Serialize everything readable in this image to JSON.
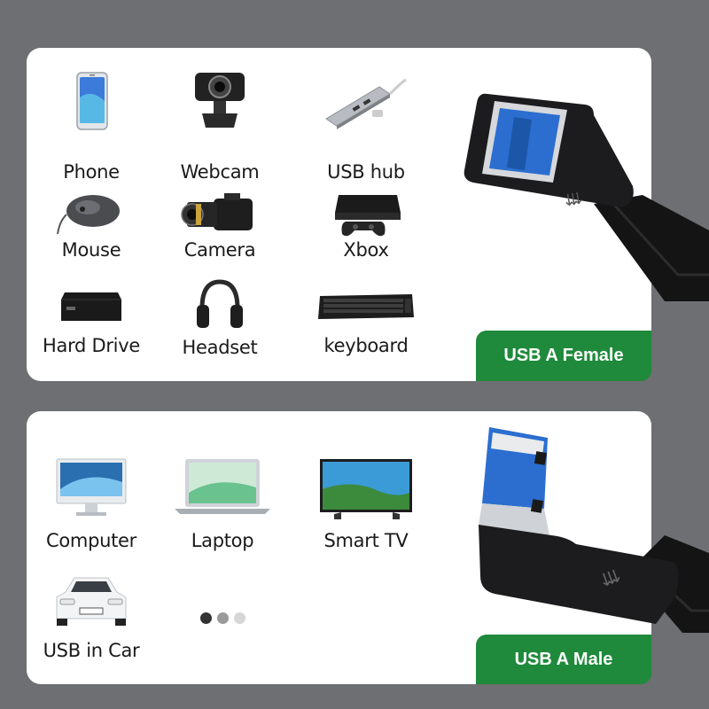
{
  "top_panel": {
    "devices": [
      {
        "label": "Phone",
        "icon": "phone-icon"
      },
      {
        "label": "Webcam",
        "icon": "webcam-icon"
      },
      {
        "label": "USB hub",
        "icon": "usb-hub-icon"
      },
      {
        "label": "Mouse",
        "icon": "mouse-icon"
      },
      {
        "label": "Camera",
        "icon": "camera-icon"
      },
      {
        "label": "Xbox",
        "icon": "console-icon"
      },
      {
        "label": "Hard Drive",
        "icon": "hard-drive-icon"
      },
      {
        "label": "Headset",
        "icon": "headset-icon"
      },
      {
        "label": "keyboard",
        "icon": "keyboard-icon"
      }
    ],
    "badge": "USB A Female"
  },
  "bottom_panel": {
    "devices": [
      {
        "label": "Computer",
        "icon": "computer-icon"
      },
      {
        "label": "Laptop",
        "icon": "laptop-icon"
      },
      {
        "label": "Smart TV",
        "icon": "tv-icon"
      },
      {
        "label": "USB in Car",
        "icon": "car-icon"
      }
    ],
    "badge": "USB A Male"
  },
  "carousel": {
    "dots": [
      "#333333",
      "#9a9a9a",
      "#d6d6d6"
    ]
  },
  "colors": {
    "background": "#6d6f72",
    "panel": "#ffffff",
    "badge_green": "#1f8a3b",
    "usb_blue": "#2b6ed0",
    "cable_black": "#1c1c1e"
  }
}
